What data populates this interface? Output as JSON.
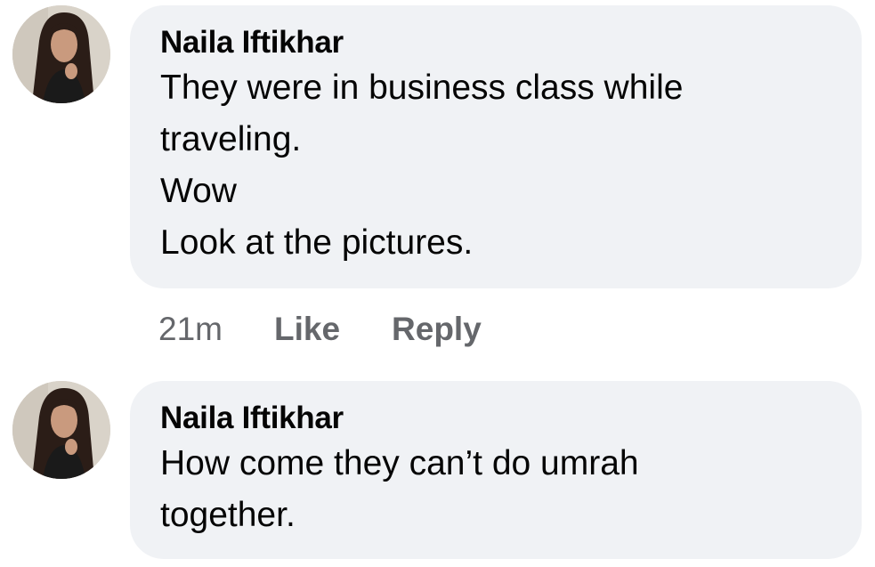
{
  "comments": [
    {
      "author": "Naila Iftikhar",
      "lines": [
        "They were in business class while",
        "traveling.",
        "Wow",
        "Look at the pictures."
      ],
      "timestamp": "21m",
      "like_label": "Like",
      "reply_label": "Reply"
    },
    {
      "author": "Naila Iftikhar",
      "lines": [
        "How come they can’t do umrah",
        "together."
      ]
    }
  ],
  "colors": {
    "bubble": "#f0f2f5",
    "text": "#050505",
    "meta": "#65676b"
  },
  "icons": [
    "profile-photo-avatar"
  ]
}
